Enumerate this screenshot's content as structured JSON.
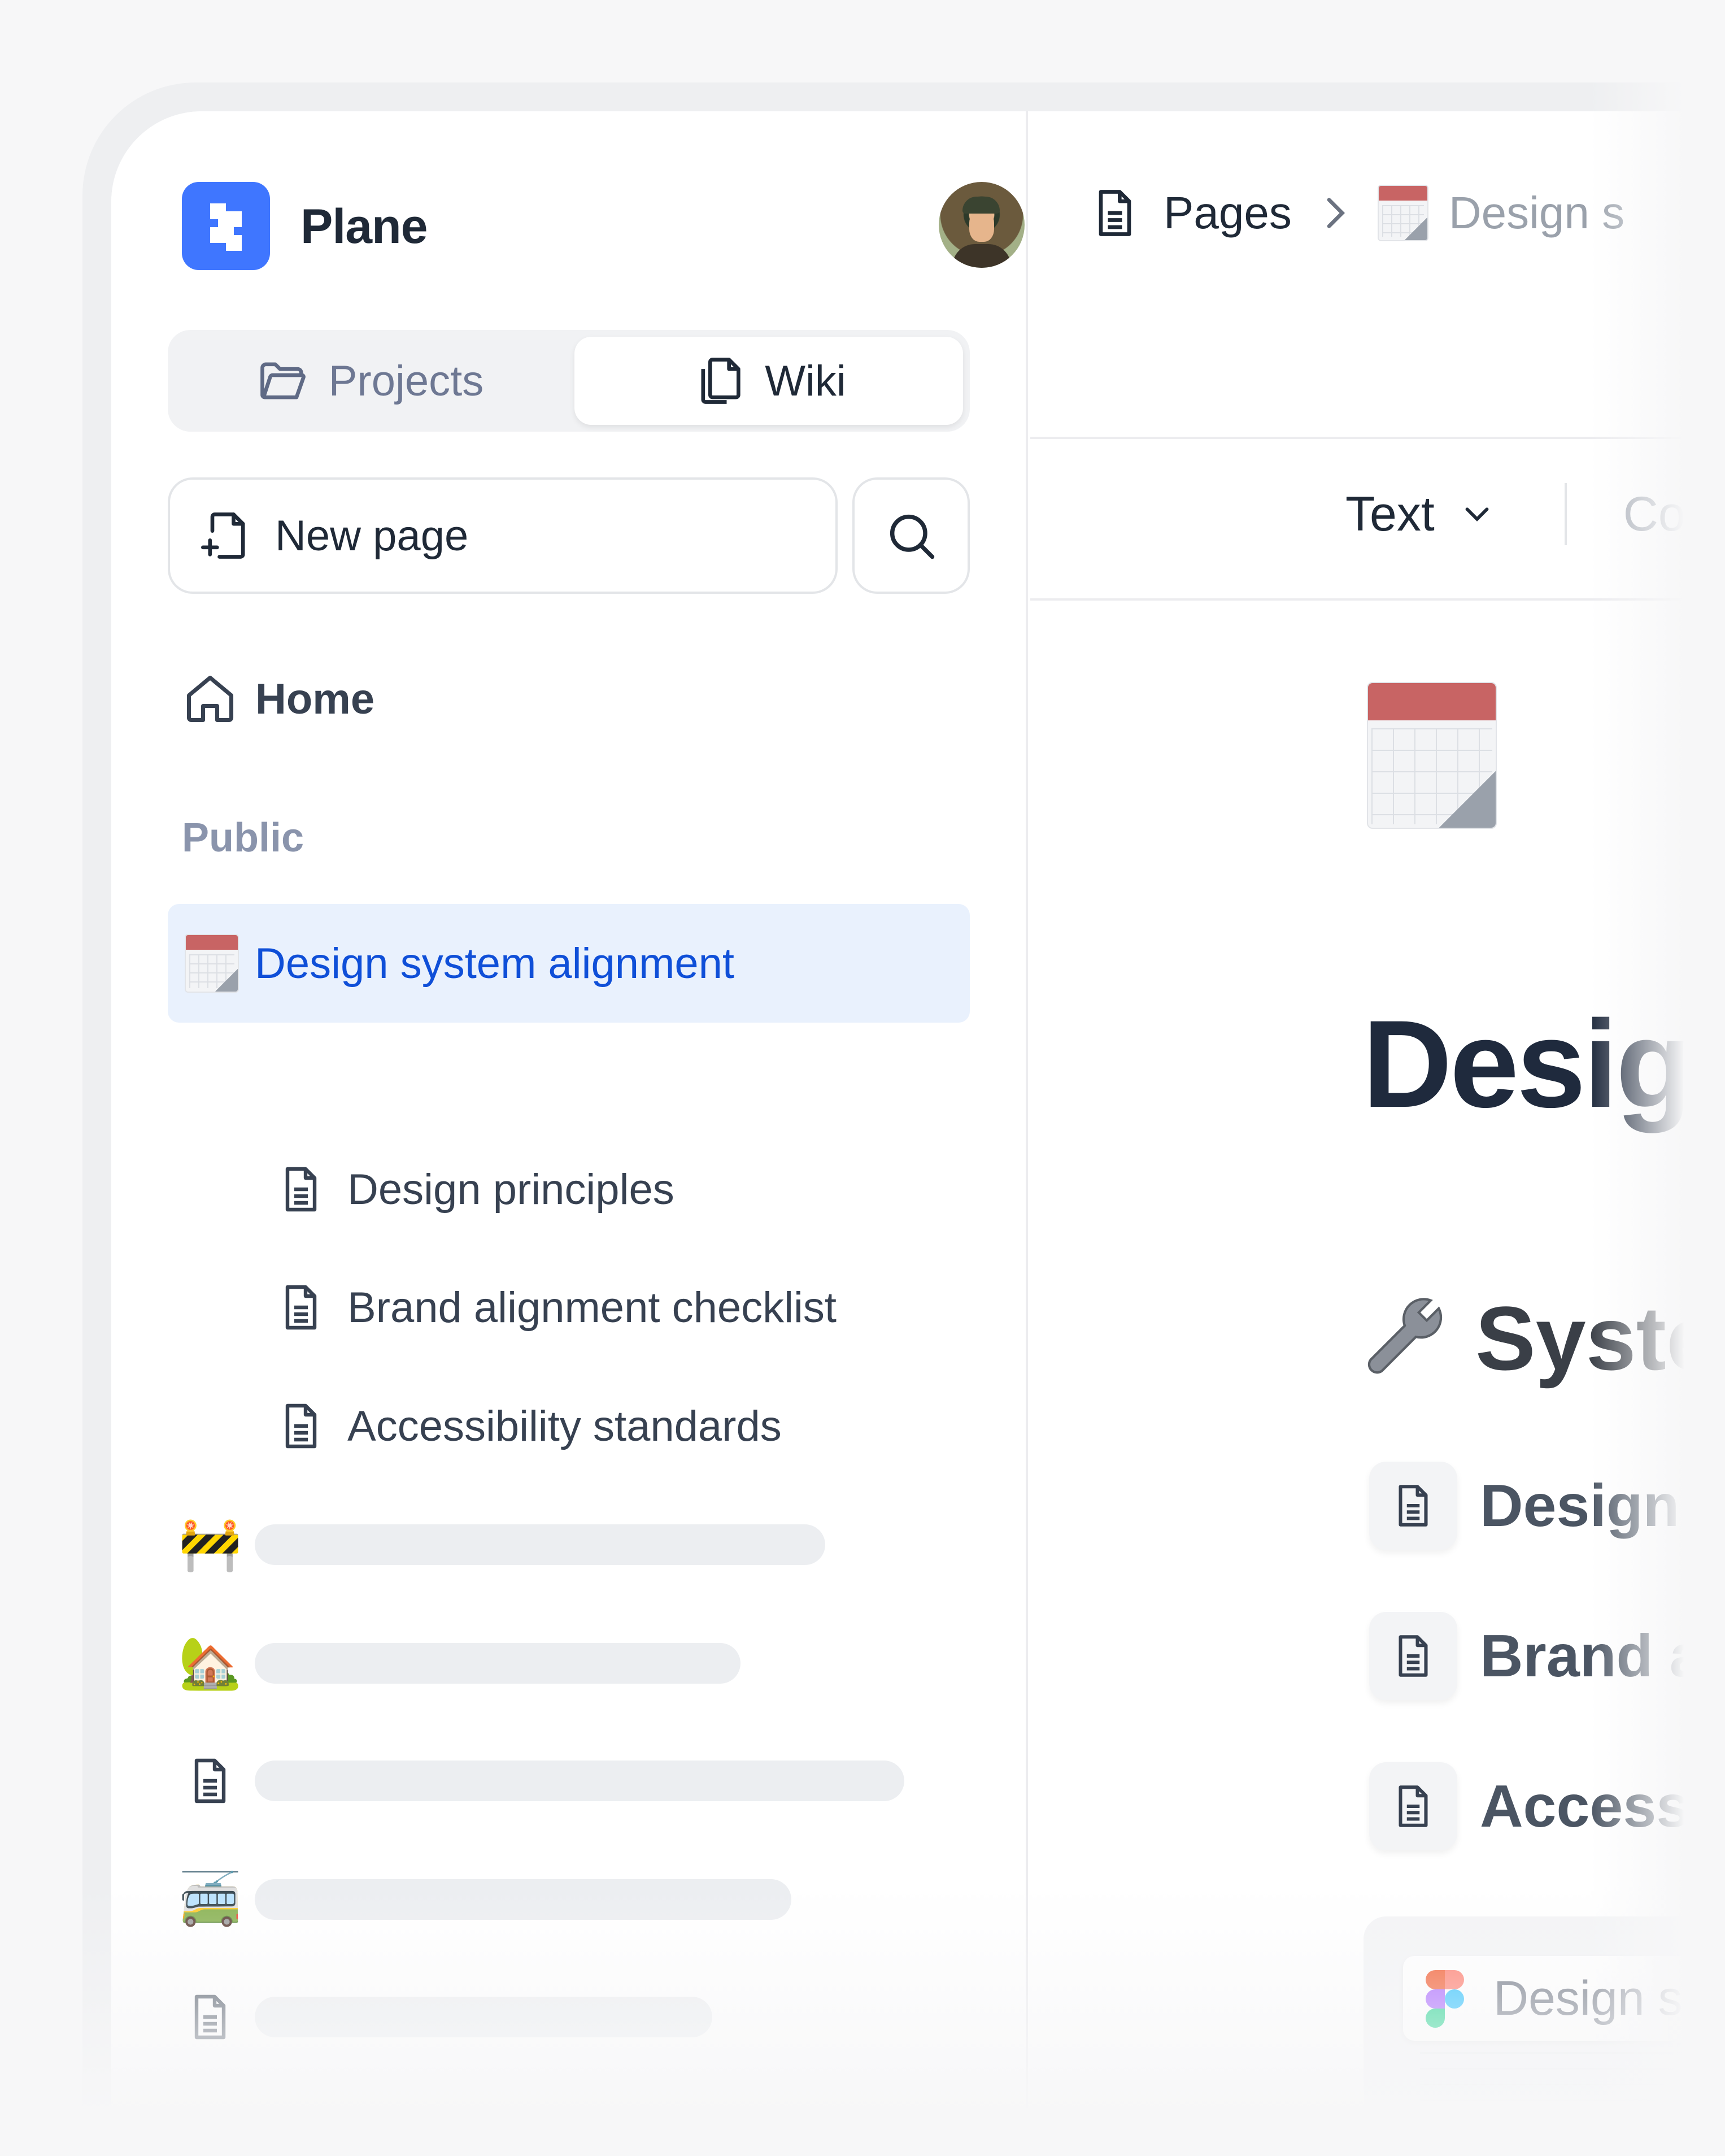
{
  "app": {
    "name": "Plane"
  },
  "sidebar": {
    "tabs": [
      {
        "label": "Projects",
        "icon": "folder-open-icon",
        "active": false
      },
      {
        "label": "Wiki",
        "icon": "files-icon",
        "active": true
      }
    ],
    "new_page_label": "New page",
    "home_label": "Home",
    "section_label": "Public",
    "active_page": {
      "label": "Design system alignment",
      "icon": "calendar-icon"
    },
    "child_pages": [
      {
        "label": "Design principles"
      },
      {
        "label": "Brand alignment checklist"
      },
      {
        "label": "Accessibility standards"
      }
    ],
    "placeholder_items": [
      {
        "icon": "construction-barrier-icon",
        "glyph": "🚧"
      },
      {
        "icon": "house-with-garden-icon",
        "glyph": "🏡"
      },
      {
        "icon": "document-icon",
        "glyph": ""
      },
      {
        "icon": "trolleybus-icon",
        "glyph": "🚎"
      },
      {
        "icon": "document-icon",
        "glyph": ""
      },
      {
        "icon": "document-icon",
        "glyph": ""
      }
    ]
  },
  "main": {
    "breadcrumb": {
      "root": "Pages",
      "current": "Design s"
    },
    "toolbar": {
      "text_style": "Text",
      "color": "Color"
    },
    "document": {
      "title": "Desig",
      "section_heading": "Syste",
      "section_icon": "wrench-icon",
      "links": [
        "Design",
        "Brand a",
        "Access"
      ],
      "embed_title": "Design s"
    }
  },
  "colors": {
    "accent": "#3f76ff",
    "active_bg": "#e9f1fd",
    "active_text": "#0f4fd8"
  }
}
